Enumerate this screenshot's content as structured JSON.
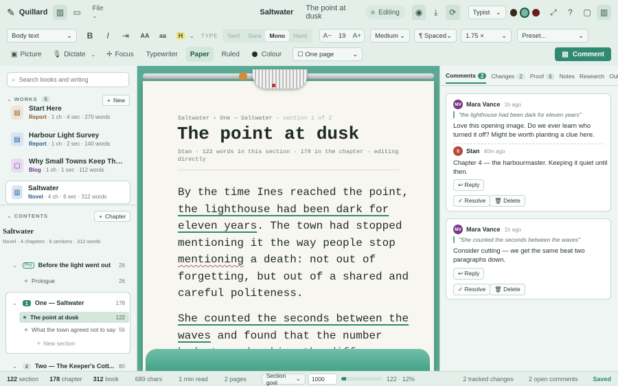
{
  "app": {
    "name": "Quillard",
    "file_menu": "File"
  },
  "header": {
    "work_title": "Saltwater",
    "section_title": "The point at dusk",
    "mode": "Editing",
    "theme": "Typist"
  },
  "format": {
    "style": "Body text",
    "bold": "B",
    "italic": "I",
    "indent": "⇥",
    "upper": "AA",
    "lower": "aa",
    "highlight": "H",
    "type_label": "TYPE",
    "fonts": [
      "Serif",
      "Sans",
      "Mono",
      "Hand"
    ],
    "active_font": "Mono",
    "size_dec": "A−",
    "size": "19",
    "size_inc": "A+",
    "weight": "Medium",
    "spacing": "¶ Spaced",
    "line_height": "1.75 ×",
    "preset": "Preset..."
  },
  "tools": {
    "picture": "Picture",
    "dictate": "Dictate",
    "focus": "Focus",
    "typewriter": "Typewriter",
    "paper": "Paper",
    "ruled": "Ruled",
    "colour": "Colour",
    "layout": "☐ One page",
    "comment_btn": "Comment"
  },
  "left": {
    "search_placeholder": "Search books and writing",
    "works_label": "WORKS",
    "works_count": "6",
    "new_btn": "New",
    "works": [
      {
        "title": "Start Here",
        "kind": "Report",
        "meta": "1 ch · 4 sec · 270 words"
      },
      {
        "title": "Harbour Light Survey",
        "kind": "Report",
        "meta": "1 ch · 2 sec · 140 words"
      },
      {
        "title": "Why Small Towns Keep Their...",
        "kind": "Blog",
        "meta": "1 ch · 1 sec · 112 words"
      },
      {
        "title": "Saltwater",
        "kind": "Novel",
        "meta": "4 ch · 6 sec · 312 words"
      }
    ],
    "contents_label": "CONTENTS",
    "chapter_btn": "Chapter",
    "book_title": "Saltwater",
    "book_meta": "Novel · 4 chapters · 6 sections · 312 words",
    "chapters": [
      {
        "badge": "Pro",
        "title": "Before the light went out",
        "count": "26"
      },
      {
        "title": "Prologue",
        "count": "26"
      },
      {
        "badge": "1",
        "title": "One — Saltwater",
        "count": "178"
      },
      {
        "title": "The point at dusk",
        "count": "122"
      },
      {
        "title": "What the town agreed not to say",
        "count": "56"
      },
      {
        "title": "New section"
      },
      {
        "badge": "2",
        "title": "Two — The Keeper's Cott...",
        "count": "80"
      }
    ]
  },
  "doc": {
    "breadcrumb": [
      "Saltwater",
      "One — Saltwater",
      "section 1 of 2"
    ],
    "title": "The point at dusk",
    "meta": "Stan · 122 words in this section · 178 in the chapter · editing directly",
    "p1": [
      "By the time Ines reached the point,",
      "the lighthouse had been dark for",
      "eleven years",
      ". The town had stopped",
      "mentioning it the way people stop",
      "mentioning",
      " a death: not out of",
      "forgetting, but out of a shared and",
      "careful politeness."
    ],
    "p2": [
      "She counted the seconds between the",
      "waves",
      " and found that the number",
      "had stopped making the difference."
    ]
  },
  "right": {
    "tabs": [
      {
        "label": "Comments",
        "count": "2"
      },
      {
        "label": "Changes",
        "count": "2"
      },
      {
        "label": "Proof",
        "count": "6"
      },
      {
        "label": "Notes"
      },
      {
        "label": "Research"
      },
      {
        "label": "Outline"
      }
    ],
    "comments": [
      {
        "initials": "MV",
        "author": "Mara Vance",
        "time": "1h ago",
        "quote": "\"the lighthouse had been dark for eleven years\"",
        "text": "Love this opening image. Do we ever learn who turned it off? Might be worth planting a clue here.",
        "reply": {
          "initials": "S",
          "author": "Stan",
          "time": "40m ago",
          "text": "Chapter 4 — the harbourmaster. Keeping it quiet until then."
        }
      },
      {
        "initials": "MV",
        "author": "Mara Vance",
        "time": "1h ago",
        "quote": "\"She counted the seconds between the waves\"",
        "text": "Consider cutting — we get the same beat two paragraphs down."
      }
    ],
    "reply_btn": "↩ Reply",
    "resolve_btn": "✓ Resolve",
    "delete_btn": "🗑 Delete"
  },
  "status": {
    "section": "122",
    "section_l": "section",
    "chapter": "178",
    "chapter_l": "chapter",
    "book": "312",
    "book_l": "book",
    "chars": "689 chars",
    "read": "1 min read",
    "pages": "2 pages",
    "goal_label": "Section goal",
    "goal": "1000",
    "goal_progress": 0.122,
    "progress_text": "122 · 12%",
    "changes": "2 tracked changes",
    "comments": "2 open comments",
    "saved": "Saved"
  }
}
